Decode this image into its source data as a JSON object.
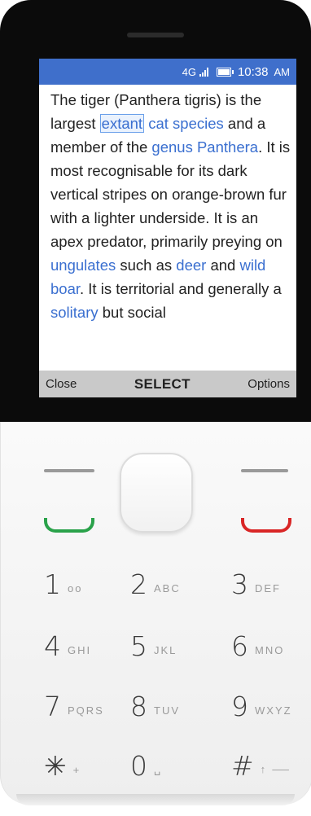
{
  "status_bar": {
    "network": "4G",
    "time": "10:38",
    "ampm": "AM"
  },
  "article": {
    "segments": [
      {
        "text": "The tiger (Panthera tigris) is the largest ",
        "link": false
      },
      {
        "text": "extant",
        "link": true,
        "focused": true
      },
      {
        "text": " ",
        "link": false
      },
      {
        "text": "cat species",
        "link": true
      },
      {
        "text": " and a member of the ",
        "link": false
      },
      {
        "text": "genus Panthera",
        "link": true
      },
      {
        "text": ". It is most recognisable for its dark vertical stripes on orange-brown fur with a lighter underside. It is an apex predator, primarily preying on ",
        "link": false
      },
      {
        "text": "ungulates",
        "link": true
      },
      {
        "text": " such as ",
        "link": false
      },
      {
        "text": "deer",
        "link": true
      },
      {
        "text": " and ",
        "link": false
      },
      {
        "text": "wild boar",
        "link": true
      },
      {
        "text": ".  It is territorial and generally a ",
        "link": false
      },
      {
        "text": "solitary",
        "link": true
      },
      {
        "text": " but social",
        "link": false
      }
    ]
  },
  "softkeys": {
    "left": "Close",
    "center": "SELECT",
    "right": "Options"
  },
  "keypad": [
    {
      "num": "1",
      "letters": "oo"
    },
    {
      "num": "2",
      "letters": "ABC"
    },
    {
      "num": "3",
      "letters": "DEF"
    },
    {
      "num": "4",
      "letters": "GHI"
    },
    {
      "num": "5",
      "letters": "JKL"
    },
    {
      "num": "6",
      "letters": "MNO"
    },
    {
      "num": "7",
      "letters": "PQRS"
    },
    {
      "num": "8",
      "letters": "TUV"
    },
    {
      "num": "9",
      "letters": "WXYZ"
    },
    {
      "num": "✳",
      "letters": "+"
    },
    {
      "num": "0",
      "letters": "␣"
    },
    {
      "num": "#",
      "letters": "↑ ⸺"
    }
  ],
  "colors": {
    "status_bar": "#3f6fcb",
    "link": "#3a6fd0",
    "call_green": "#2aa24a",
    "end_red": "#d92626"
  }
}
